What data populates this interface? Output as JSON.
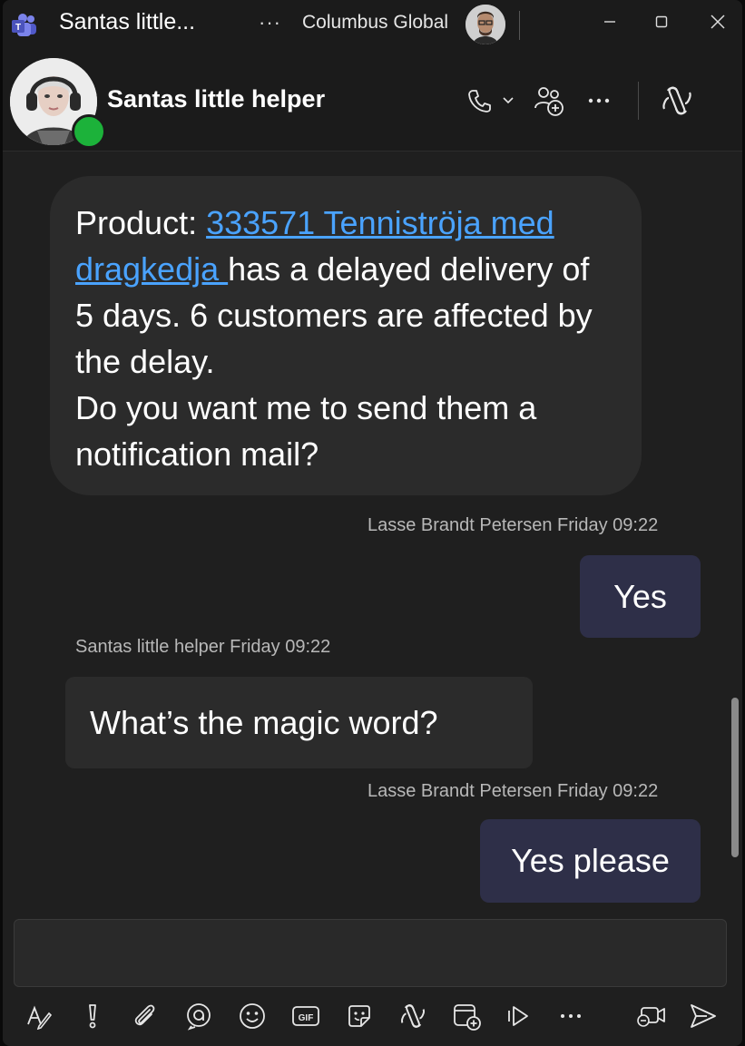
{
  "titlebar": {
    "title": "Santas little...",
    "more": "···",
    "org": "Columbus Global",
    "icons": [
      "teams-app-icon",
      "user-avatar",
      "minimize-icon",
      "maximize-icon",
      "close-icon"
    ]
  },
  "header": {
    "chat_name": "Santas little helper",
    "icons": [
      "call-icon",
      "chevron-down-icon",
      "add-people-icon",
      "more-icon",
      "copilot-icon"
    ],
    "presence": "available",
    "presence_color": "#1cb23a"
  },
  "messages": [
    {
      "from": "bot",
      "prefix": "Product: ",
      "link": "333571 Tenniströja med dragkedja ",
      "line1": " has a delayed delivery of 5 days. 6 customers are affected by the delay.",
      "line2": "Do you want me to send them a notification mail?"
    },
    {
      "from": "me",
      "meta": "Lasse Brandt Petersen Friday 09:22",
      "text": "Yes"
    },
    {
      "from": "bot",
      "meta": "Santas little helper Friday 09:22",
      "text": "What’s the magic word?"
    },
    {
      "from": "me",
      "meta": "Lasse Brandt Petersen Friday 09:22",
      "text": "Yes please"
    }
  ],
  "compose": {
    "placeholder": ""
  },
  "toolbar": {
    "more": "···",
    "icons": [
      "format-icon",
      "priority-icon",
      "attach-icon",
      "loop-icon",
      "emoji-icon",
      "gif-icon",
      "sticker-icon",
      "copilot-icon",
      "schedule-meeting-icon",
      "stream-icon",
      "more-icon",
      "meet-now-icon",
      "send-icon"
    ]
  },
  "colors": {
    "background": "#1f1f1f",
    "bubble_other": "#2b2b2b",
    "bubble_self": "#2e2f48",
    "link": "#4aa3ff"
  }
}
